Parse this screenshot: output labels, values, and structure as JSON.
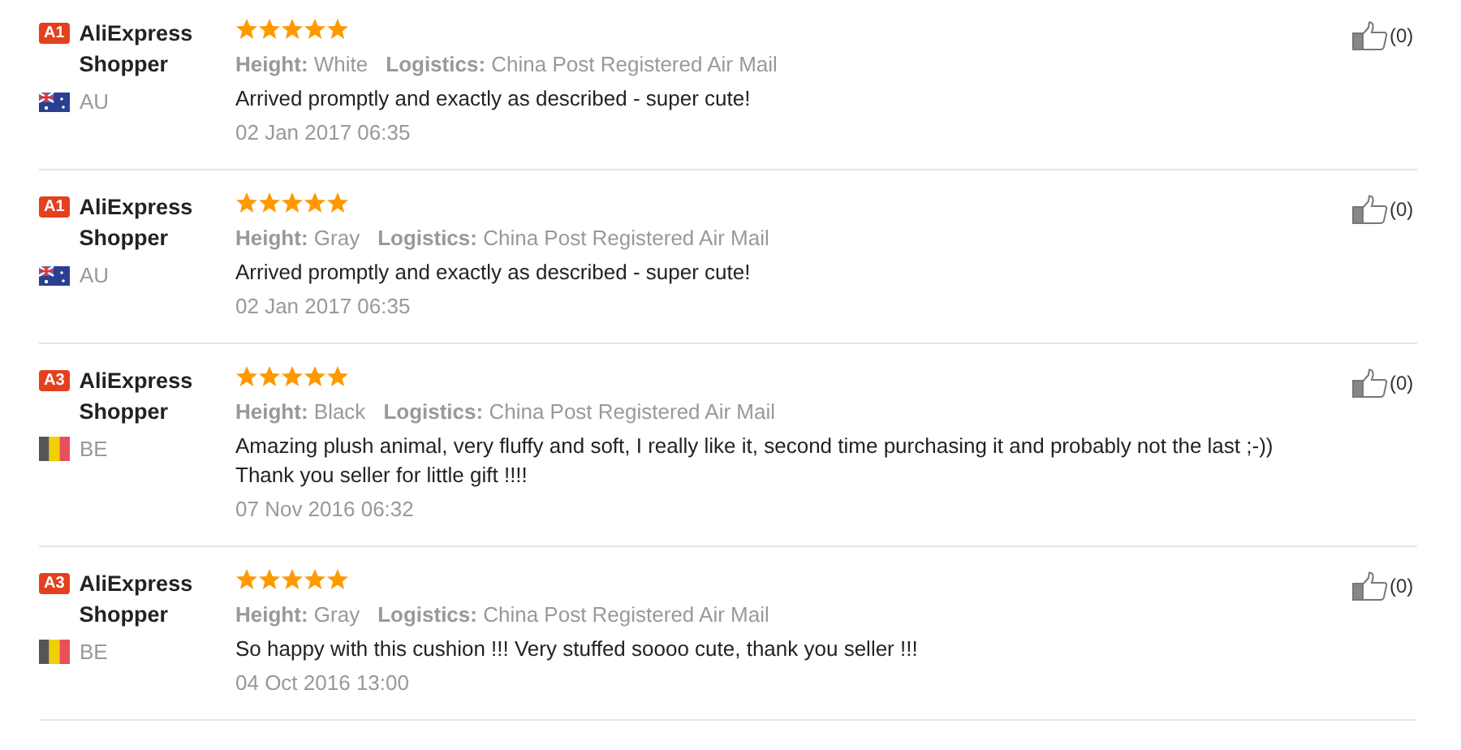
{
  "reviews": [
    {
      "badge": "A1",
      "name": "AliExpress Shopper",
      "kind": "au",
      "country": "AU",
      "stars": 5,
      "attributes": [
        {
          "label": "Height:",
          "value": "White"
        },
        {
          "label": "Logistics:",
          "value": "China Post Registered Air Mail"
        }
      ],
      "text": "Arrived promptly and exactly as described - super cute!",
      "date": "02 Jan 2017 06:35",
      "likes": "(0)"
    },
    {
      "badge": "A1",
      "name": "AliExpress Shopper",
      "kind": "au",
      "country": "AU",
      "stars": 5,
      "attributes": [
        {
          "label": "Height:",
          "value": "Gray"
        },
        {
          "label": "Logistics:",
          "value": "China Post Registered Air Mail"
        }
      ],
      "text": "Arrived promptly and exactly as described - super cute!",
      "date": "02 Jan 2017 06:35",
      "likes": "(0)"
    },
    {
      "badge": "A3",
      "name": "AliExpress Shopper",
      "kind": "be",
      "country": "BE",
      "stars": 5,
      "attributes": [
        {
          "label": "Height:",
          "value": "Black"
        },
        {
          "label": "Logistics:",
          "value": "China Post Registered Air Mail"
        }
      ],
      "text": "Amazing plush animal, very fluffy and soft, I really like it, second time purchasing it and probably not the last ;-)) Thank you seller for little gift !!!!",
      "date": "07 Nov 2016 06:32",
      "likes": "(0)"
    },
    {
      "badge": "A3",
      "name": "AliExpress Shopper",
      "kind": "be",
      "country": "BE",
      "stars": 5,
      "attributes": [
        {
          "label": "Height:",
          "value": "Gray"
        },
        {
          "label": "Logistics:",
          "value": "China Post Registered Air Mail"
        }
      ],
      "text": "So happy with this cushion !!! Very stuffed soooo cute, thank you seller !!!",
      "date": "04 Oct 2016 13:00",
      "likes": "(0)"
    }
  ]
}
